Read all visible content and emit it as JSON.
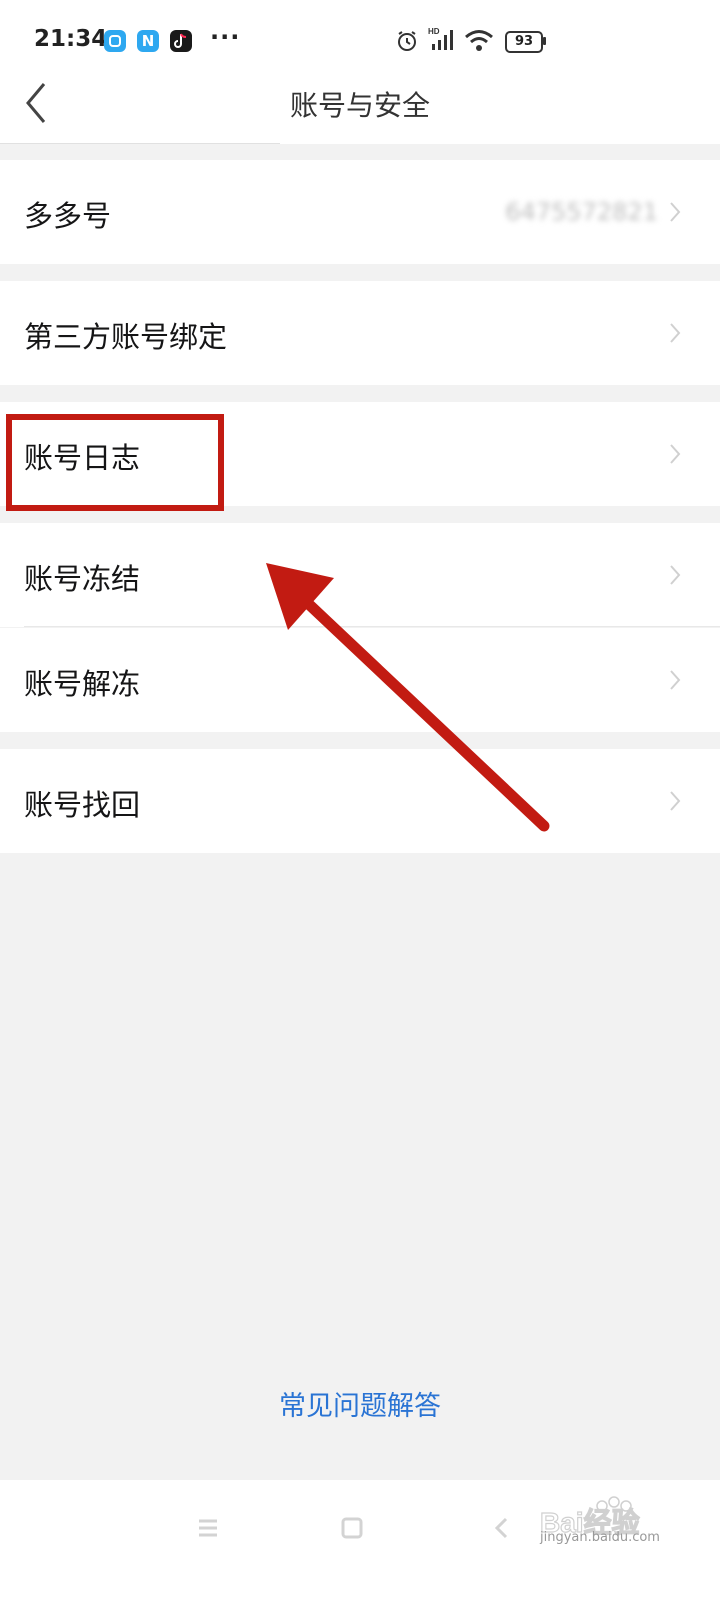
{
  "status_bar": {
    "time": "21:34",
    "icons": [
      "app-a-icon",
      "app-n-icon",
      "tiktok-icon",
      "more-dots-icon",
      "alarm-icon",
      "signal-icon",
      "wifi-icon",
      "battery-icon"
    ],
    "app_n_letter": "N",
    "dots": "···",
    "battery": "93",
    "network": "HD"
  },
  "header": {
    "title": "账号与安全"
  },
  "rows": [
    {
      "label": "多多号",
      "value": "6475572821"
    },
    {
      "label": "第三方账号绑定"
    },
    {
      "label": "账号日志"
    },
    {
      "label": "账号冻结"
    },
    {
      "label": "账号解冻"
    },
    {
      "label": "账号找回"
    }
  ],
  "faq_link": "常见问题解答",
  "watermark": {
    "text": "Bai经验",
    "subtext": "jingyan.baidu.com"
  },
  "colors": {
    "annotation": "#c21b12",
    "link": "#2a74d4"
  }
}
